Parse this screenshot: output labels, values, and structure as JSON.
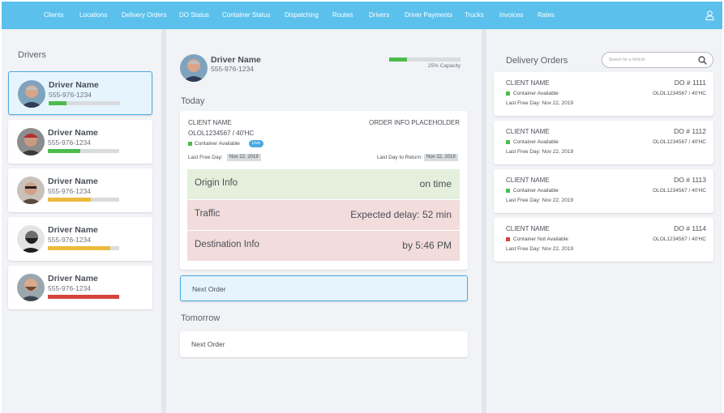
{
  "nav": {
    "items": [
      "Clients",
      "Locations",
      "Delivery Orders",
      "DO Status",
      "Container Status",
      "Dispatching",
      "Routes",
      "Drivers",
      "Driver Payments",
      "Trucks",
      "Invoices",
      "Rates"
    ],
    "user_icon": "user-icon"
  },
  "colors": {
    "nav_bg": "#5bc1ec",
    "selected_border": "#4aa9e3",
    "green": "#4cbc4c",
    "yellow": "#ecba3c",
    "red": "#d6453d"
  },
  "drivers": {
    "title": "Drivers",
    "items": [
      {
        "name": "Driver Name",
        "phone": "555-976-1234",
        "progress": 0.25,
        "bar_color": "#4cbc4c",
        "selected": true
      },
      {
        "name": "Driver Name",
        "phone": "555-976-1234",
        "progress": 0.45,
        "bar_color": "#4cbc4c",
        "selected": false
      },
      {
        "name": "Driver Name",
        "phone": "555-976-1234",
        "progress": 0.6,
        "bar_color": "#ecba3c",
        "selected": false
      },
      {
        "name": "Driver Name",
        "phone": "555-976-1234",
        "progress": 0.88,
        "bar_color": "#ecba3c",
        "selected": false
      },
      {
        "name": "Driver Name",
        "phone": "555-976-1234",
        "progress": 1.0,
        "bar_color": "#d6453d",
        "selected": false
      }
    ]
  },
  "main": {
    "driver_name": "Driver Name",
    "driver_phone": "555-976-1234",
    "capacity_text": "25% Capacity",
    "capacity": 0.25,
    "today_title": "Today",
    "tomorrow_title": "Tomorrow",
    "today_card": {
      "client": "CLIENT NAME",
      "order_info": "ORDER INFO PLACEHOLDER",
      "container": "OLOL1234567 / 40'HC",
      "status": "Container Available",
      "badge": "Live",
      "last_free_day_label": "Last Free Day:",
      "last_free_day": "Nov 22, 2019",
      "last_day_return_label": "Last Day to Return:",
      "last_day_return": "Nov 22, 2019",
      "rows": [
        {
          "label": "Origin Info",
          "value": "on time"
        },
        {
          "label": "Traffic",
          "value": "Expected delay: 52 min"
        },
        {
          "label": "Destination Info",
          "value": "by 5:46 PM"
        }
      ]
    },
    "next_order_label": "Next Order",
    "tomorrow_next_order_label": "Next Order"
  },
  "delivery_orders": {
    "title": "Delivery Orders",
    "search_placeholder": "Search for a Vehicle",
    "items": [
      {
        "client": "CLIENT NAME",
        "do_number": "DO # 1111",
        "status": "Container Available",
        "status_color": "#4cbc4c",
        "container": "OLOL1234567 / 40'HC",
        "lfd": "Last Free Day:   Nov 22, 2019"
      },
      {
        "client": "CLIENT NAME",
        "do_number": "DO # 1112",
        "status": "Container Available",
        "status_color": "#4cbc4c",
        "container": "OLOL1234567 / 40'HC",
        "lfd": "Last Free Day:   Nov 22, 2019"
      },
      {
        "client": "CLIENT NAME",
        "do_number": "DO # 1113",
        "status": "Container Available",
        "status_color": "#4cbc4c",
        "container": "OLOL1234567 / 40'HC",
        "lfd": "Last Free Day:   Nov 22, 2019"
      },
      {
        "client": "CLIENT NAME",
        "do_number": "DO # 1114",
        "status": "Container Not Available",
        "status_color": "#d6453d",
        "container": "OLOL1234567 / 40'HC",
        "lfd": "Last Free Day:   Nov 22, 2019"
      }
    ]
  }
}
